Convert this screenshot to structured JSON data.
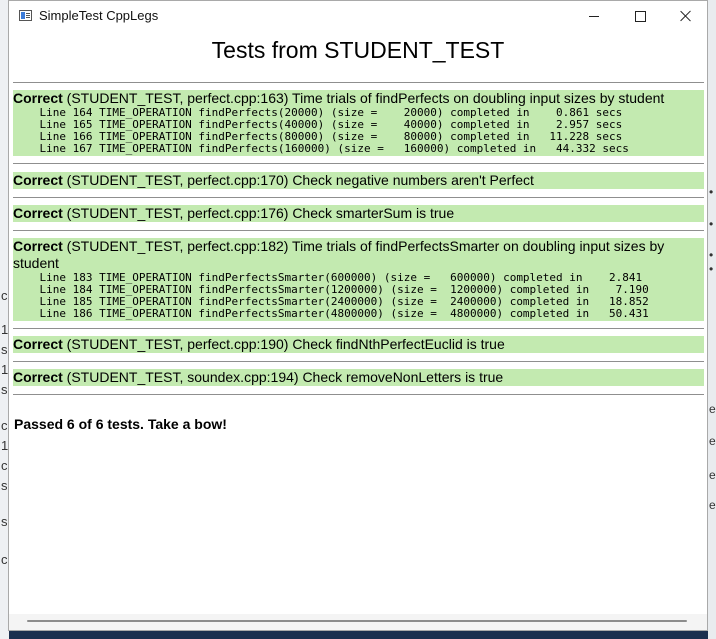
{
  "window": {
    "title": "SimpleTest CppLegs"
  },
  "heading": "Tests from STUDENT_TEST",
  "tests": [
    {
      "status": "Correct",
      "description": " (STUDENT_TEST, perfect.cpp:163) Time trials of findPerfects on doubling input sizes by student",
      "lines": [
        "    Line 164 TIME_OPERATION findPerfects(20000) (size =    20000) completed in    0.861 secs",
        "    Line 165 TIME_OPERATION findPerfects(40000) (size =    40000) completed in    2.957 secs",
        "    Line 166 TIME_OPERATION findPerfects(80000) (size =    80000) completed in   11.228 secs",
        "    Line 167 TIME_OPERATION findPerfects(160000) (size =   160000) completed in   44.332 secs"
      ]
    },
    {
      "status": "Correct",
      "description": " (STUDENT_TEST, perfect.cpp:170) Check negative numbers aren't Perfect",
      "lines": []
    },
    {
      "status": "Correct",
      "description": " (STUDENT_TEST, perfect.cpp:176) Check smarterSum is true",
      "lines": []
    },
    {
      "status": "Correct",
      "description": " (STUDENT_TEST, perfect.cpp:182) Time trials of findPerfectsSmarter on doubling input sizes by student",
      "lines": [
        "    Line 183 TIME_OPERATION findPerfectsSmarter(600000) (size =   600000) completed in    2.841",
        "    Line 184 TIME_OPERATION findPerfectsSmarter(1200000) (size =  1200000) completed in    7.190",
        "    Line 185 TIME_OPERATION findPerfectsSmarter(2400000) (size =  2400000) completed in   18.852",
        "    Line 186 TIME_OPERATION findPerfectsSmarter(4800000) (size =  4800000) completed in   50.431"
      ]
    },
    {
      "status": "Correct",
      "description": " (STUDENT_TEST, perfect.cpp:190) Check findNthPerfectEuclid is true",
      "lines": []
    },
    {
      "status": "Correct",
      "description": " (STUDENT_TEST, soundex.cpp:194) Check removeNonLetters is true",
      "lines": []
    }
  ],
  "summary": "Passed 6 of 6 tests. Take a bow!",
  "background_glyphs": {
    "left": [
      "c",
      "1",
      "s",
      "1",
      "s",
      "c",
      "1",
      "c",
      "s",
      "s",
      "c"
    ],
    "right": [
      "•",
      "•",
      "•",
      "•",
      "e",
      "e",
      "e",
      "e"
    ]
  },
  "colors": {
    "correct_bg": "#c3eab0",
    "desktop": "#1b2f4e"
  }
}
